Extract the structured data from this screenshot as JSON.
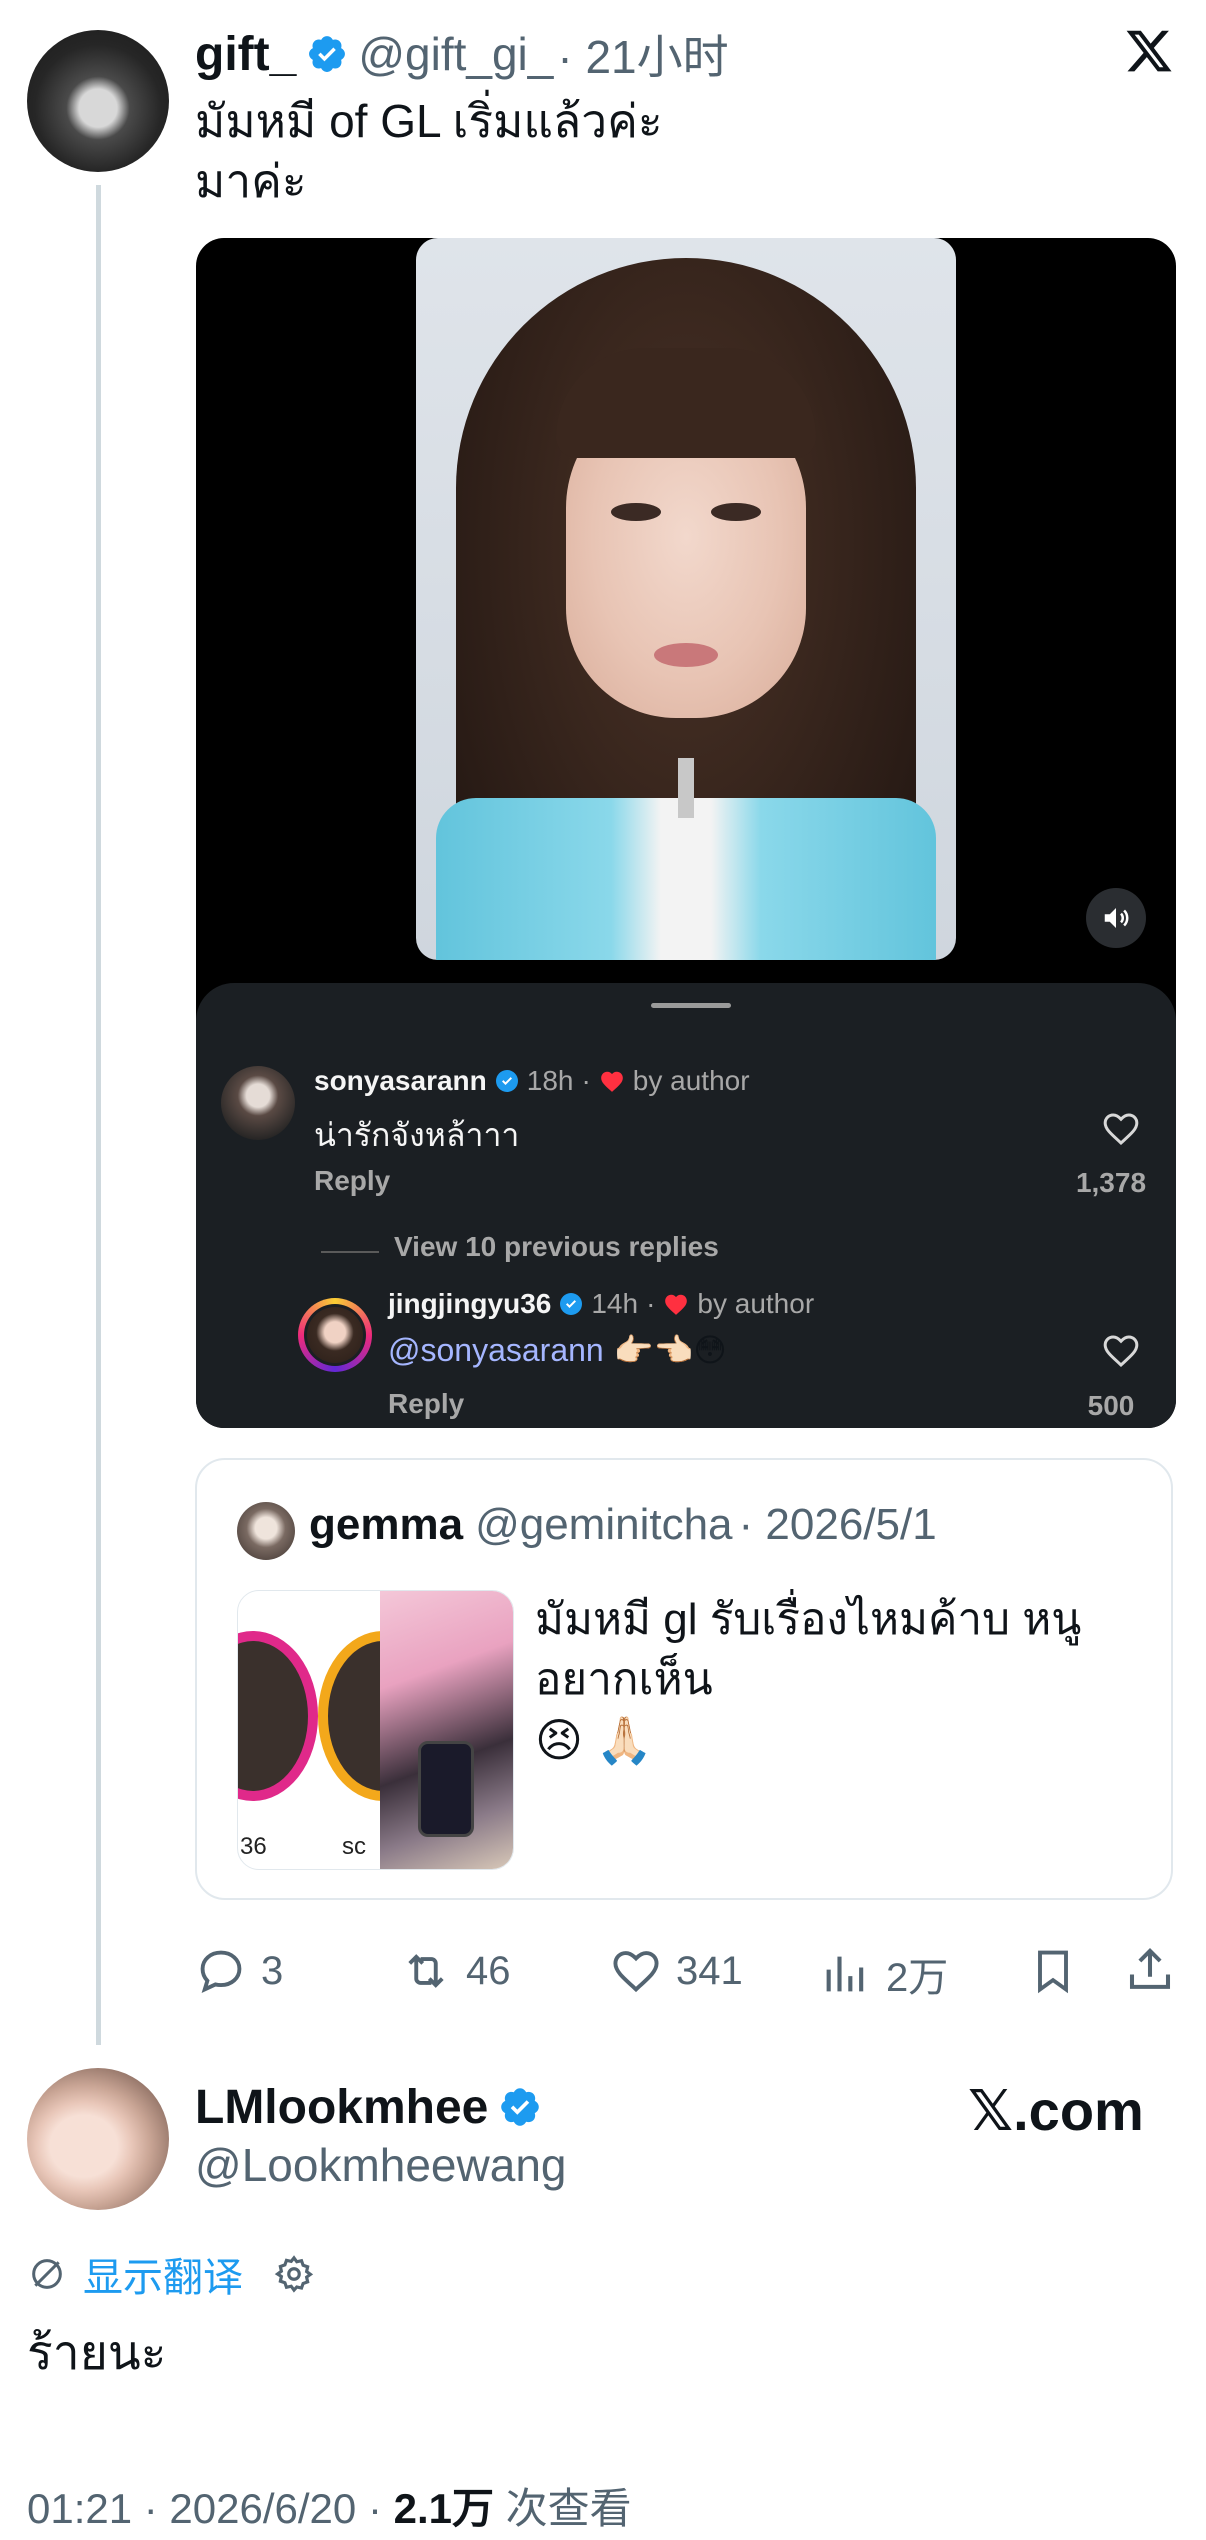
{
  "tweet": {
    "author_name": "gift_",
    "author_handle": "@gift_gi_",
    "time": "· 21小时",
    "text_line1": "มัมหมี of GL เริ่มแล้วค่ะ",
    "text_line2": "มาค่ะ",
    "logo_icon": "x-logo-icon"
  },
  "media": {
    "sound_icon": "speaker-icon",
    "comment1": {
      "user": "sonyasarann",
      "time": "18h",
      "by_author": "by author",
      "text": "น่ารักจังหล้าาา",
      "reply": "Reply",
      "likes": "1,378"
    },
    "view_replies": "View 10 previous replies",
    "comment2": {
      "user": "jingjingyu36",
      "time": "14h",
      "by_author": "by author",
      "mention": "@sonyasarann",
      "emoji": "👉🏻👈🏻😳",
      "reply": "Reply",
      "likes": "500"
    }
  },
  "quote": {
    "name": "gemma",
    "handle": "@geminitcha",
    "date": "· 2026/5/1",
    "text_line1": "มัมหมี gl รับเรื่องไหมค้าบ หนู",
    "text_line2": "อยากเห็น",
    "emoji": "😣 🙏🏻",
    "thumb_label1": "36",
    "thumb_label2": "sc"
  },
  "actions": {
    "replies": "3",
    "retweets": "46",
    "likes": "341",
    "views": "2万"
  },
  "reply": {
    "author_name": "LMlookmhee",
    "author_handle": "@Lookmheewang",
    "brand": "𝕏.com",
    "translate_label": "显示翻译",
    "text": "ร้ายนะ",
    "time": "01:21 · 2026/6/20 · ",
    "views_count": "2.1万",
    "views_label": " 次查看"
  },
  "colors": {
    "verified_blue": "#1d9bf0",
    "link_blue": "#1d9bf0",
    "ig_mention": "#a5b6ff",
    "heart_red": "#ff3040"
  }
}
